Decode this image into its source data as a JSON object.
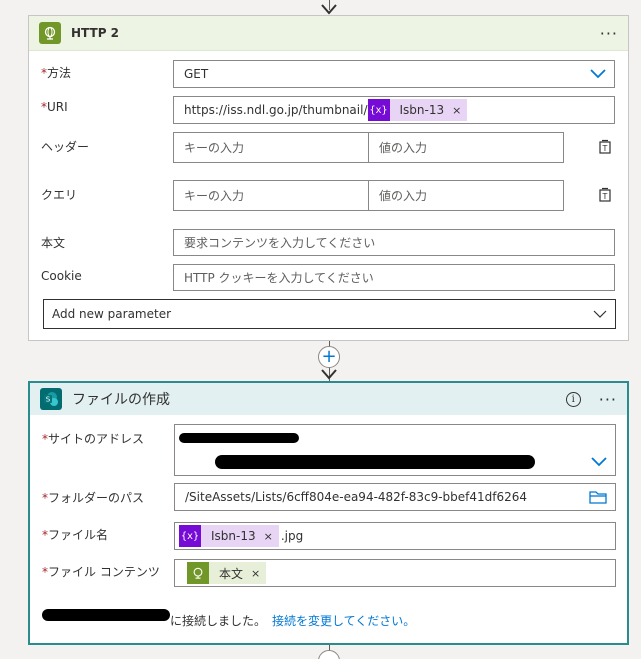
{
  "http_card": {
    "title": "HTTP 2",
    "more": "···",
    "method_label": "方法",
    "method_value": "GET",
    "uri_label": "URI",
    "uri_prefix": "https://iss.ndl.go.jp/thumbnail/",
    "uri_token": "Isbn-13",
    "token_icon": "{x}",
    "headers_label": "ヘッダー",
    "query_label": "クエリ",
    "key_placeholder": "キーの入力",
    "value_placeholder": "値の入力",
    "body_label": "本文",
    "body_placeholder": "要求コンテンツを入力してください",
    "cookie_label": "Cookie",
    "cookie_placeholder": "HTTP クッキーを入力してください",
    "add_param": "Add new parameter"
  },
  "file_card": {
    "title": "ファイルの作成",
    "info": "i",
    "more": "···",
    "site_label": "サイトのアドレス",
    "folder_label": "フォルダーのパス",
    "folder_value": "/SiteAssets/Lists/6cff804e-ea94-482f-83c9-bbef41df6264",
    "filename_label": "ファイル名",
    "filename_token": "Isbn-13",
    "filename_suffix": ".jpg",
    "token_icon": "{x}",
    "content_label": "ファイル コンテンツ",
    "content_token": "本文",
    "connected_text": "に接続しました。",
    "change_link": "接続を変更してください。"
  },
  "required_mark": "*",
  "plus": "+",
  "remove": "×",
  "colors": {
    "http_accent": "#709727",
    "sharepoint_accent": "#036c70",
    "token_purple": "#770bd6",
    "link": "#0078d4",
    "required": "#a4262c"
  }
}
